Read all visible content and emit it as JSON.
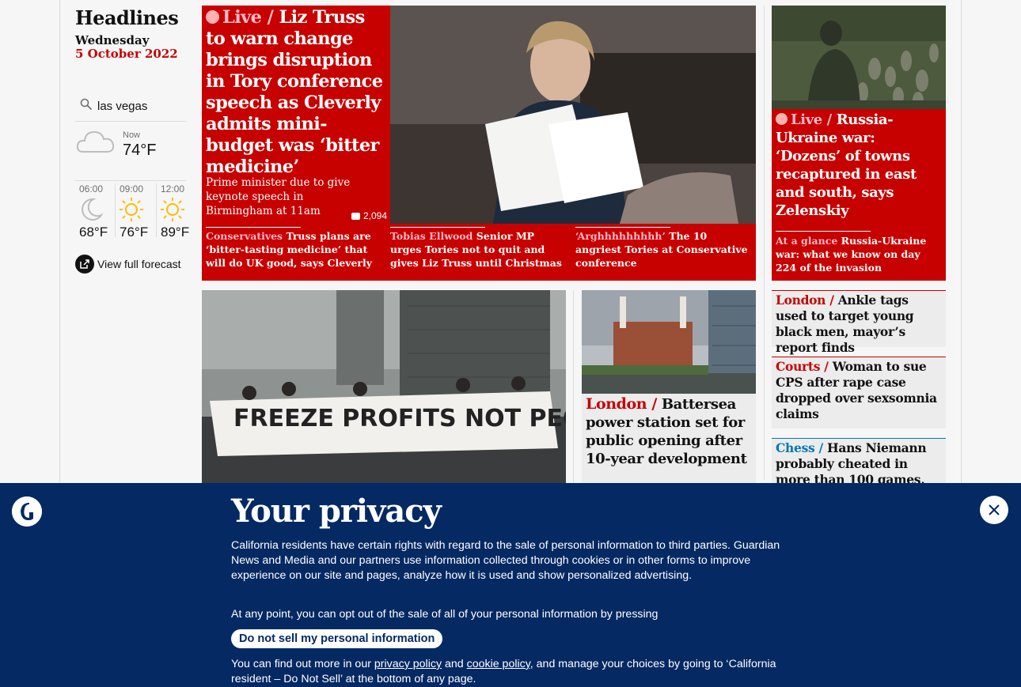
{
  "left": {
    "title": "Headlines",
    "day": "Wednesday",
    "date": "5 October 2022",
    "weather": {
      "location": "las vegas",
      "now_label": "Now",
      "now_temp": "74°F",
      "forecast": [
        {
          "time": "06:00",
          "temp": "68°F",
          "icon": "moon-icon"
        },
        {
          "time": "09:00",
          "temp": "76°F",
          "icon": "sun-icon"
        },
        {
          "time": "12:00",
          "temp": "89°F",
          "icon": "sun-icon"
        }
      ],
      "full_forecast": "View full forecast"
    }
  },
  "lead": {
    "kicker": "Live /",
    "headline": " Liz Truss to warn change brings disruption in Tory conference speech as Cleverly admits mini-budget was ‘bitter medicine’",
    "standfirst": "Prime minister due to give keynote speech in Birmingham at 11am",
    "comments": "2,094",
    "subs": [
      {
        "kicker": "Conservatives",
        "text": " Truss plans are ‘bitter-tasting medicine’ that will do UK good, says Cleverly"
      },
      {
        "kicker": "Tobias Ellwood",
        "text": " Senior MP urges Tories not to quit and gives Liz Truss until Christmas"
      },
      {
        "kicker": "‘Arghhhhhhhhh’",
        "text": " The 10 angriest Tories at Conservative conference"
      }
    ]
  },
  "right_top": {
    "kicker": "Live /",
    "headline": " Russia-Ukraine war: ‘Dozens’ of towns recaptured in east and south, says Zelenskiy",
    "sub_kicker": "At a glance",
    "sub_text": " Russia-Ukraine war: what we know on day 224 of the invasion"
  },
  "battersea": {
    "kicker": "London /",
    "headline": " Battersea power station set for public opening after 10-year development"
  },
  "small_stories": [
    {
      "kicker": "London /",
      "headline": " Ankle tags used to target young black men, mayor’s report finds"
    },
    {
      "kicker": "Courts /",
      "headline": " Woman to sue CPS after rape case dropped over sexsomnia claims"
    },
    {
      "kicker": "Chess /",
      "headline": " Hans Niemann probably cheated in more than 100 games,"
    }
  ],
  "photo": {
    "banner_text": "FREEZE PROFITS NOT PEOPLE"
  },
  "privacy": {
    "title": "Your privacy",
    "body1": "California residents have certain rights with regard to the sale of personal information to third parties. Guardian News and Media and our partners use information collected through cookies or in other forms to improve experience on our site and pages, analyze how it is used and show personalized advertising.",
    "body2": "At any point, you can opt out of the sale of all of your personal information by pressing",
    "button": "Do not sell my personal information",
    "body3_a": "You can find out more in our ",
    "privacy_link": "privacy policy",
    "body3_b": " and ",
    "cookie_link": "cookie policy",
    "body3_c": ", and manage your choices by going to ‘California resident – Do Not Sell’ at the bottom of any page."
  }
}
